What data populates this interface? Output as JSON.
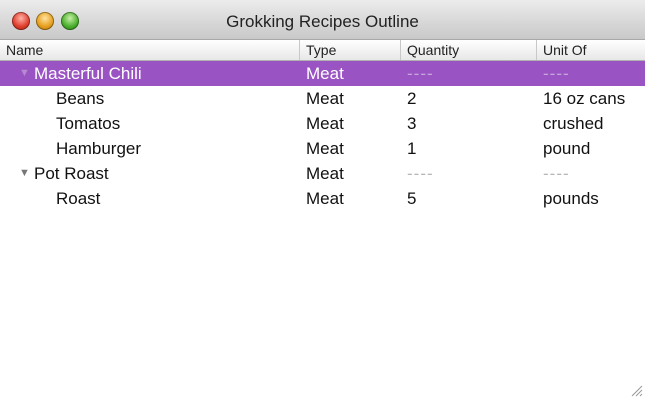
{
  "window": {
    "title": "Grokking Recipes Outline"
  },
  "columns": [
    "Name",
    "Type",
    "Quantity",
    "Unit Of"
  ],
  "rows": [
    {
      "name": "Masterful Chili",
      "type": "Meat",
      "quantity": "----",
      "unit": "----",
      "selected": true,
      "expanded": true
    },
    {
      "name": "Beans",
      "type": "Meat",
      "quantity": "2",
      "unit": "16 oz cans"
    },
    {
      "name": "Tomatos",
      "type": "Meat",
      "quantity": "3",
      "unit": "crushed"
    },
    {
      "name": "Hamburger",
      "type": "Meat",
      "quantity": "1",
      "unit": "pound"
    },
    {
      "name": "Pot Roast",
      "type": "Meat",
      "quantity": "----",
      "unit": "----",
      "expanded": true
    },
    {
      "name": "Roast",
      "type": "Meat",
      "quantity": "5",
      "unit": "pounds"
    }
  ],
  "icons": {
    "expanded": "disclosure-triangle-down-icon"
  },
  "colors": {
    "selection": "#9a53c3"
  }
}
